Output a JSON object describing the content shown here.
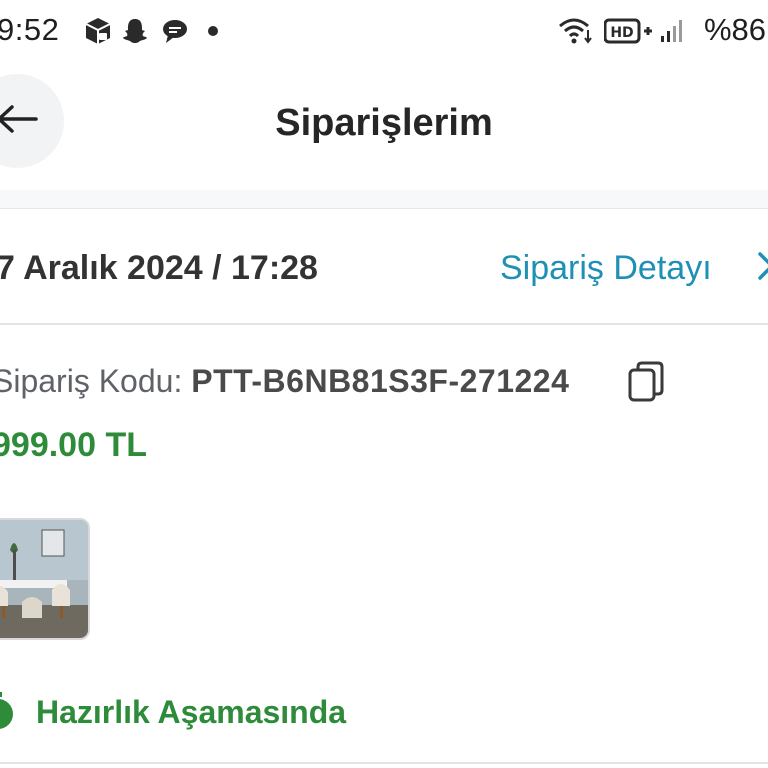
{
  "status_bar": {
    "time": "9:52",
    "left_icons": [
      "package-lock-icon",
      "snapchat-icon",
      "chat-bubble-icon",
      "dot-icon"
    ],
    "right_icons": [
      "wifi-icon",
      "hd-plus-icon",
      "signal-icon"
    ],
    "battery": "%86"
  },
  "header": {
    "back_icon": "arrow-left-icon",
    "title": "Siparişlerim"
  },
  "order": {
    "date": "7 Aralık 2024 / 17:28",
    "detail_link": "Sipariş Detayı",
    "code_label": "Sipariş Kodu:",
    "code_value": "PTT-B6NB81S3F-271224",
    "copy_icon": "copy-icon",
    "price": "999.00 TL",
    "thumbnail": "dining-table-set-image",
    "status": "Hazırlık Aşamasında",
    "status_icon": "timer-icon"
  },
  "colors": {
    "link": "#1e8fb5",
    "success": "#2e8b3a",
    "text": "#2b2b2b"
  }
}
